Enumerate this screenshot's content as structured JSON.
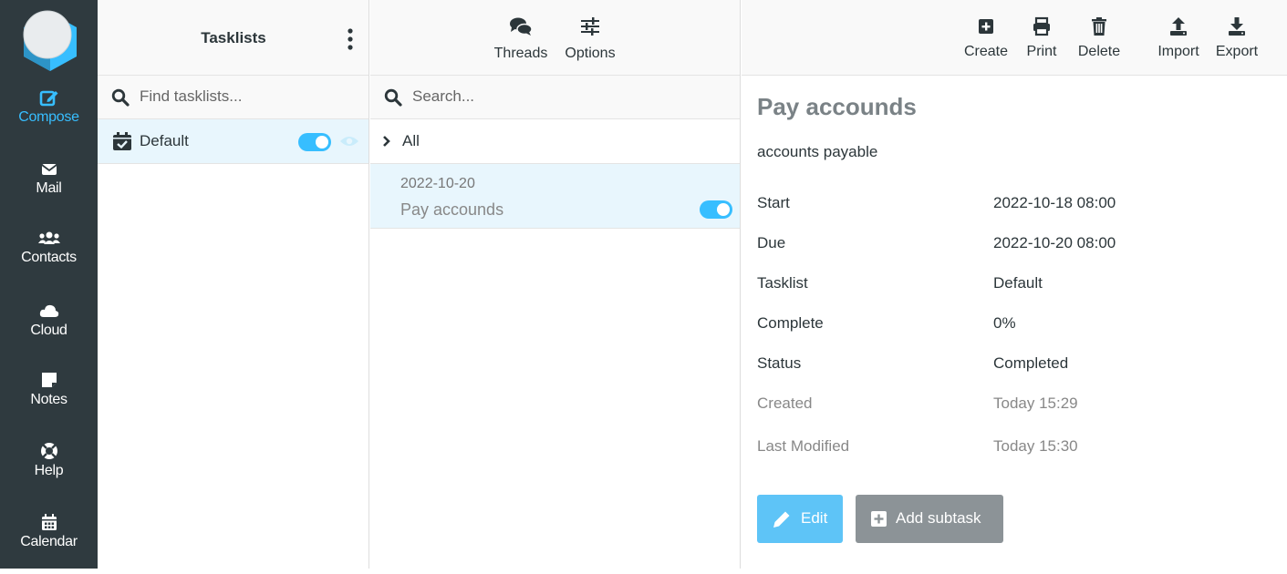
{
  "nav": {
    "items": [
      {
        "label": "Compose",
        "icon": "compose-icon"
      },
      {
        "label": "Mail",
        "icon": "envelope-icon"
      },
      {
        "label": "Contacts",
        "icon": "users-icon"
      },
      {
        "label": "Cloud",
        "icon": "cloud-icon"
      },
      {
        "label": "Notes",
        "icon": "sticky-note-icon"
      },
      {
        "label": "Help",
        "icon": "lifebuoy-icon"
      },
      {
        "label": "Calendar",
        "icon": "calendar-icon"
      }
    ],
    "active": "Compose",
    "accent": "#37beff"
  },
  "tasklists": {
    "title": "Tasklists",
    "search_placeholder": "Find tasklists...",
    "items": [
      {
        "name": "Default",
        "enabled": true
      }
    ]
  },
  "tasks": {
    "toolbar": {
      "threads": "Threads",
      "options": "Options"
    },
    "search_placeholder": "Search...",
    "group": "All",
    "items": [
      {
        "date": "2022-10-20",
        "title": "Pay accounds",
        "enabled": true
      }
    ]
  },
  "detail": {
    "toolbar": {
      "create": "Create",
      "print": "Print",
      "delete": "Delete",
      "import": "Import",
      "export": "Export"
    },
    "title": "Pay accounds",
    "description": "accounts payable",
    "fields": [
      {
        "key": "Start",
        "value": "2022-10-18 08:00"
      },
      {
        "key": "Due",
        "value": "2022-10-20 08:00"
      },
      {
        "key": "Tasklist",
        "value": "Default"
      },
      {
        "key": "Complete",
        "value": "0%"
      },
      {
        "key": "Status",
        "value": "Completed"
      },
      {
        "key": "Created",
        "value": "Today 15:29"
      },
      {
        "key": "Last Modified",
        "value": "Today 15:30"
      }
    ],
    "buttons": {
      "edit": "Edit",
      "add_subtask": "Add subtask"
    }
  }
}
